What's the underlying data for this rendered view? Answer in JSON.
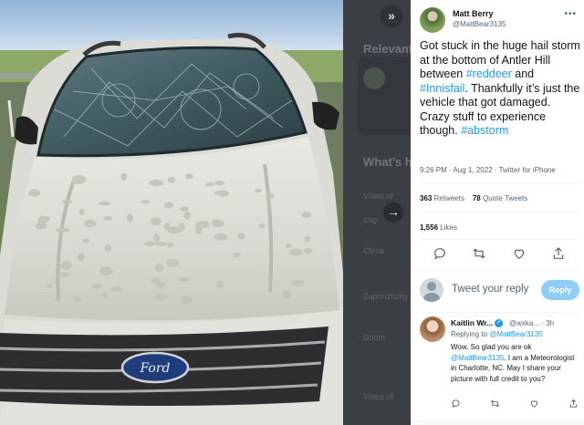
{
  "tweet": {
    "author_name": "Matt Berry",
    "author_handle": "@MattBear3135",
    "body_parts": [
      {
        "text": "Got stuck in the huge hail storm at the bottom of Antler Hill between ",
        "hashtag": false
      },
      {
        "text": "#reddeer",
        "hashtag": true
      },
      {
        "text": " and ",
        "hashtag": false
      },
      {
        "text": "#Innisfail",
        "hashtag": true
      },
      {
        "text": ". Thankfully it’s just the vehicle that got damaged. Crazy stuff to experience though. ",
        "hashtag": false
      },
      {
        "text": "#abstorm",
        "hashtag": true
      }
    ],
    "timestamp": "9:26 PM · Aug 1, 2022 · Twitter for iPhone",
    "retweets_count": "363",
    "retweets_label": "Retweets",
    "quote_count": "78",
    "quote_label": "Quote Tweets",
    "likes_count": "1,556",
    "likes_label": "Likes"
  },
  "reply_composer": {
    "placeholder": "Tweet your reply",
    "button_label": "Reply"
  },
  "reply": {
    "author_name": "Kaitlin Wr...",
    "author_handle": "@wxka...",
    "age": "· 3h",
    "replying_to_prefix": "Replying to ",
    "replying_to_handle": "@MattBear3135",
    "body_before": "Wow. So glad you are ok ",
    "body_mention": "@MattBear3135",
    "body_after": ". I am a Meteorologist in Charlotte, NC. May I share your picture with full credit to you?"
  },
  "backdrop": {
    "relevant_heading": "Relevant",
    "whats_happening": "What’s h",
    "items": [
      "Video of",
      "ong",
      "Clima",
      "Zaporizhzhy",
      "Doom",
      "Video of"
    ]
  },
  "icons": {
    "collapse": "double-chevron-right-icon",
    "next": "arrow-right-icon",
    "more": "more-horizontal-icon",
    "reply": "reply-icon",
    "retweet": "retweet-icon",
    "like": "heart-icon",
    "share": "share-icon",
    "verified": "verified-badge-icon"
  },
  "colors": {
    "accent": "#1d9bf0",
    "reply_button": "#8ecdf8",
    "backdrop": "#3b3f43"
  }
}
